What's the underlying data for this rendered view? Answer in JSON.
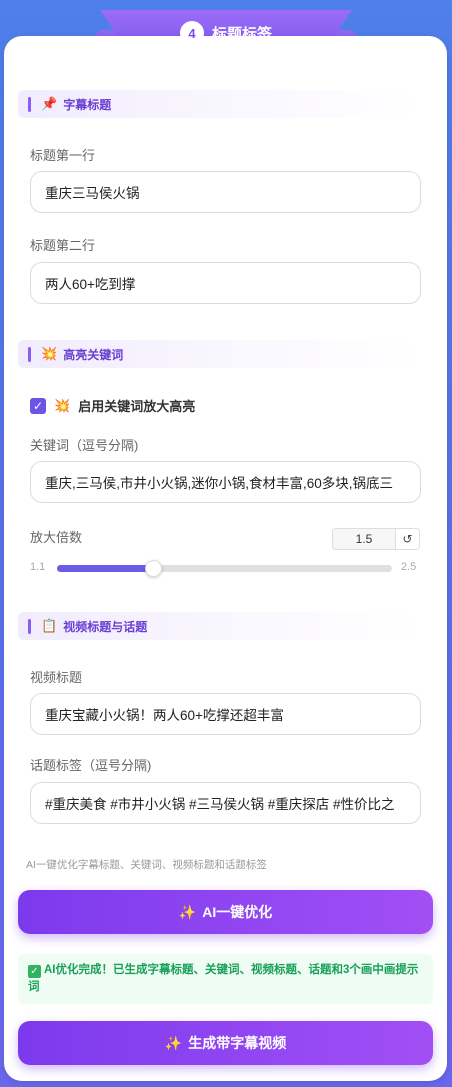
{
  "header": {
    "step_number": "4",
    "title": "标题标签"
  },
  "subtitle_section": {
    "heading": "字幕标题",
    "heading_icon": "pushpin-icon",
    "line1_label": "标题第一行",
    "line1_value": "重庆三马侯火锅",
    "line2_label": "标题第二行",
    "line2_value": "两人60+吃到撑"
  },
  "keyword_section": {
    "heading": "高亮关键词",
    "heading_icon": "sparkle-burst-icon",
    "enable_checkbox_label": "启用关键词放大高亮",
    "enable_checked": true,
    "keywords_label": "关键词（逗号分隔)",
    "keywords_value": "重庆,三马侯,市井小火锅,迷你小锅,食材丰富,60多块,锅底三",
    "scale_label": "放大倍数",
    "scale_value": "1.5",
    "scale_reset_glyph": "↺",
    "scale_min": "1.1",
    "scale_max": "2.5",
    "scale_fraction": 0.286
  },
  "video_section": {
    "heading": "视频标题与话题",
    "heading_icon": "clipboard-icon",
    "title_label": "视频标题",
    "title_value": "重庆宝藏小火锅！两人60+吃撑还超丰富",
    "tags_label": "话题标签（逗号分隔)",
    "tags_value": "#重庆美食 #市井小火锅 #三马侯火锅 #重庆探店 #性价比之"
  },
  "hint_text": "AI一键优化字幕标题、关键词、视频标题和话题标签",
  "ai_optimize_button": "AI一键优化",
  "success_message": "AI优化完成！已生成字幕标题、关键词、视频标题、话题和3个画中画提示词",
  "generate_button": "生成带字幕视频",
  "colors": {
    "accent": "#7c3aed",
    "success": "#18a058",
    "background": "#5a72ea"
  }
}
